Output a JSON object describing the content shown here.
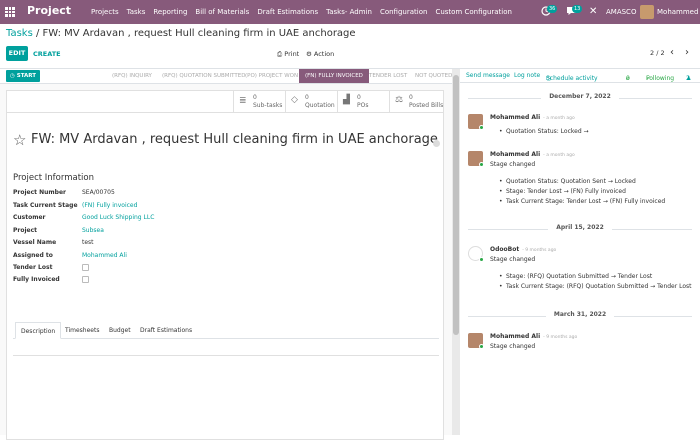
{
  "topbar": {
    "brand": "Project",
    "menu": [
      "Projects",
      "Tasks",
      "Reporting",
      "Bill of Materials",
      "Draft Estimations",
      "Tasks- Admin",
      "Configuration",
      "Custom Configuration"
    ],
    "activity_count": "36",
    "message_count": "13",
    "company": "AMASCO",
    "user": "Mohammed Ali",
    "colors": {
      "brand": "#875a7b",
      "accent": "#00a09d"
    }
  },
  "control": {
    "breadcrumb_parent": "Tasks",
    "breadcrumb_sep": "/",
    "breadcrumb_current": "FW: MV Ardavan , request Hull cleaning firm in UAE anchorage",
    "edit": "EDIT",
    "create": "CREATE",
    "print": "Print",
    "action": "Action",
    "pager": "2 / 2"
  },
  "statusbar": {
    "start": "START",
    "stages": [
      "(RFQ) INQUIRY",
      "(RFQ) QUOTATION SUBMITTED",
      "(PO) PROJECT WON",
      "(FN) FULLY INVOICED",
      "TENDER LOST",
      "NOT QUOTED"
    ],
    "active_stage": "(FN) FULLY INVOICED"
  },
  "smart_buttons": [
    {
      "count": "0",
      "label": "Sub-tasks",
      "icon": "stack-icon"
    },
    {
      "count": "0",
      "label": "Quotation",
      "icon": "diamond-icon"
    },
    {
      "count": "0",
      "label": "POs",
      "icon": "chart-icon"
    },
    {
      "count": "0",
      "label": "Posted Bills",
      "icon": "scale-icon"
    }
  ],
  "form": {
    "title": "FW: MV Ardavan , request Hull cleaning firm in UAE anchorage",
    "section": "Project Information",
    "fields": [
      {
        "label": "Project Number",
        "value": "SEA/00705"
      },
      {
        "label": "Task Current Stage",
        "value": "(FN) Fully invoiced"
      },
      {
        "label": "Customer",
        "value": "Good Luck Shipping LLC"
      },
      {
        "label": "Project",
        "value": "Subsea"
      },
      {
        "label": "Vessel Name",
        "value": "test"
      },
      {
        "label": "Assigned to",
        "value": "Mohammed Ali"
      },
      {
        "label": "Tender Lost",
        "value": ""
      },
      {
        "label": "Fully Invoiced",
        "value": ""
      }
    ],
    "tabs": [
      "Description",
      "Timesheets",
      "Budget",
      "Draft Estimations"
    ]
  },
  "chatter": {
    "send_message": "Send message",
    "log_note": "Log note",
    "schedule_activity": "Schedule activity",
    "attachments": "0",
    "following": "Following",
    "followers": "2",
    "dates": [
      "December 7, 2022",
      "April 15, 2022",
      "March 31, 2022"
    ],
    "messages": [
      {
        "author": "Mohammed Ali",
        "ago": "- a month ago",
        "text": "",
        "items": [
          "Quotation Status: Locked →"
        ]
      },
      {
        "author": "Mohammed Ali",
        "ago": "- a month ago",
        "text": "Stage changed",
        "items": [
          "Quotation Status: Quotation Sent → Locked",
          "Stage: Tender Lost → (FN) Fully invoiced",
          "Task Current Stage: Tender Lost → (FN) Fully invoiced"
        ]
      },
      {
        "author": "OdooBot",
        "ago": "- 9 months ago",
        "text": "Stage changed",
        "items": [
          "Stage: (RFQ) Quotation Submitted → Tender Lost",
          "Task Current Stage: (RFQ) Quotation Submitted → Tender Lost"
        ]
      },
      {
        "author": "Mohammed Ali",
        "ago": "- 9 months ago",
        "text": "Stage changed",
        "items": []
      }
    ]
  }
}
